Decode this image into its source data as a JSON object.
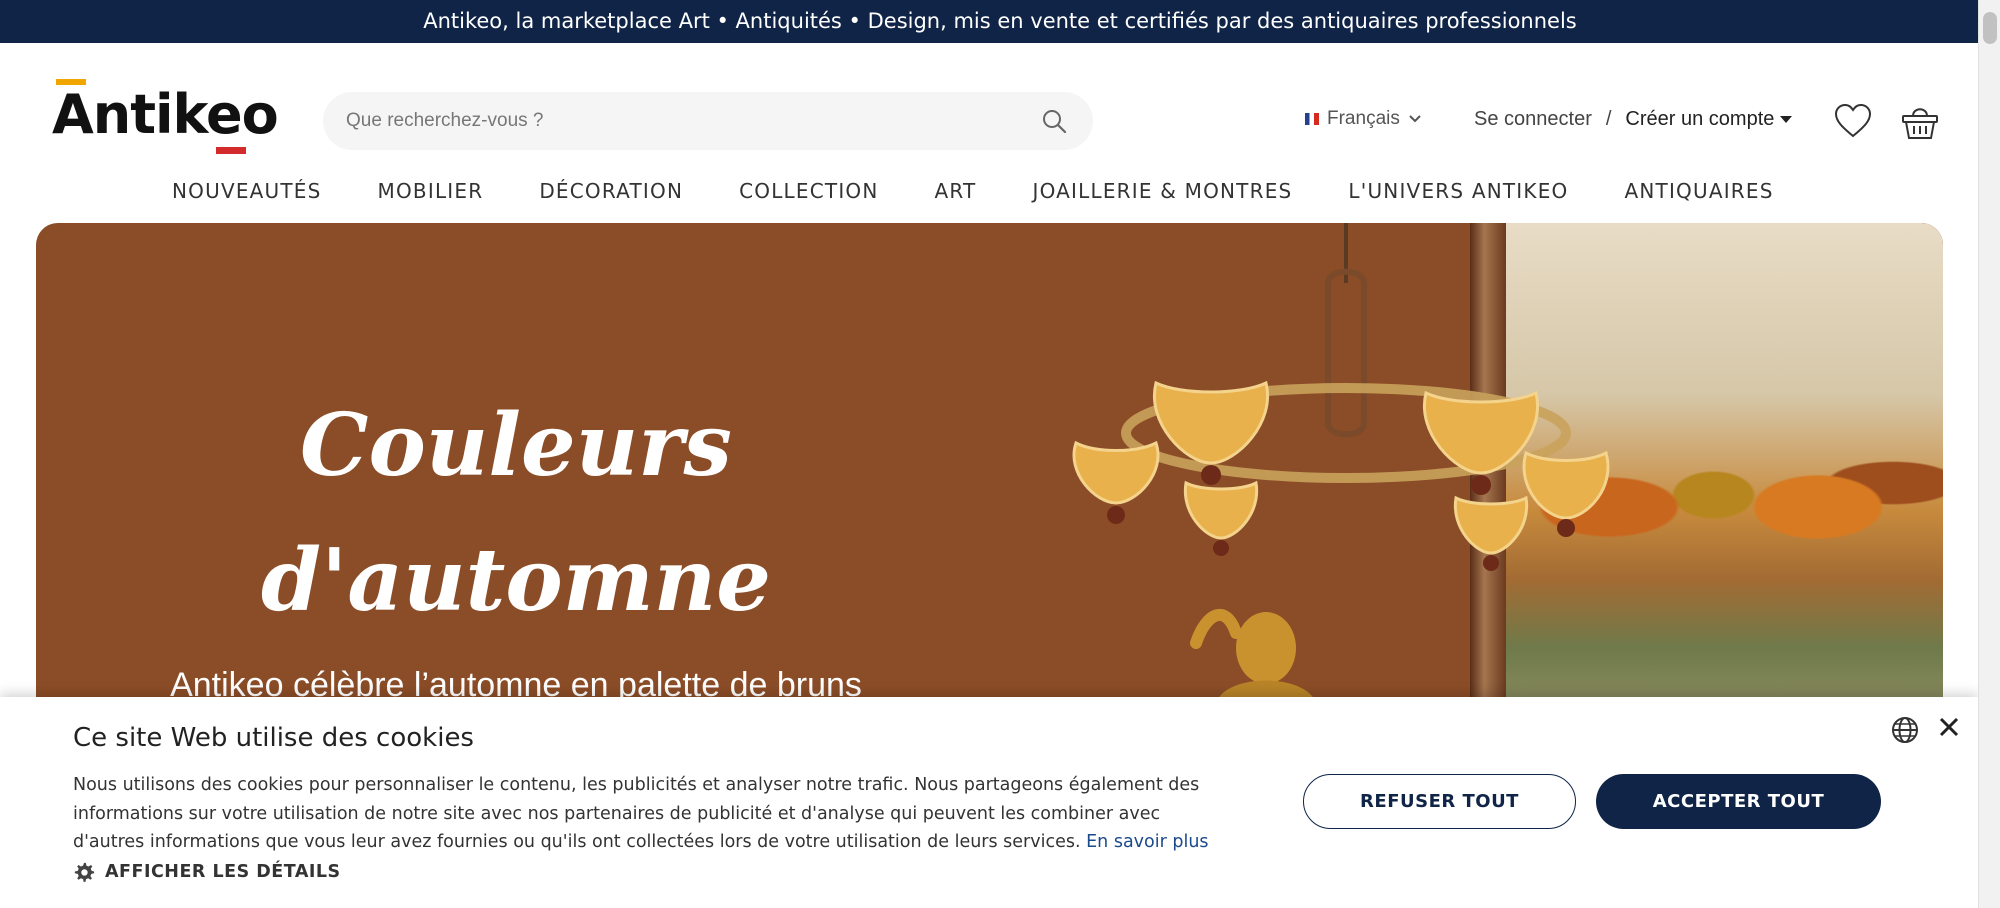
{
  "announcement": "Antikeo, la marketplace Art • Antiquités • Design, mis en vente et certifiés par des antiquaires professionnels",
  "header": {
    "logo_text": "Antikeo",
    "search_placeholder": "Que recherchez-vous ?",
    "language": "Français",
    "login": "Se connecter",
    "separator": "/",
    "create_account": "Créer un compte"
  },
  "nav": {
    "items": [
      "NOUVEAUTÉS",
      "MOBILIER",
      "DÉCORATION",
      "COLLECTION",
      "ART",
      "JOAILLERIE & MONTRES",
      "L'UNIVERS ANTIKEO",
      "ANTIQUAIRES"
    ]
  },
  "hero": {
    "title_line1": "Couleurs",
    "title_line2": "d'automne",
    "subtitle": "Antikeo célèbre l’automne en palette de bruns"
  },
  "cookie": {
    "title": "Ce site Web utilise des cookies",
    "text": "Nous utilisons des cookies pour personnaliser le contenu, les publicités et analyser notre trafic. Nous partageons également des informations sur votre utilisation de notre site avec nos partenaires de publicité et d'analyse qui peuvent les combiner avec d'autres informations que vous leur avez fournies ou qu'ils ont collectées lors de votre utilisation de leurs services.",
    "link": "En savoir plus",
    "details": "AFFICHER LES DÉTAILS",
    "refuse": "REFUSER TOUT",
    "accept": "ACCEPTER TOUT"
  },
  "colors": {
    "navy": "#0f2447",
    "hero_brown": "#8b4d27",
    "logo_accent_red": "#d32b2b",
    "logo_accent_yellow": "#f0a500"
  },
  "icons": [
    "search-icon",
    "flag-icon",
    "chevron-down-icon",
    "caret-down-icon",
    "heart-icon",
    "basket-icon",
    "gear-icon",
    "globe-icon",
    "close-icon"
  ]
}
